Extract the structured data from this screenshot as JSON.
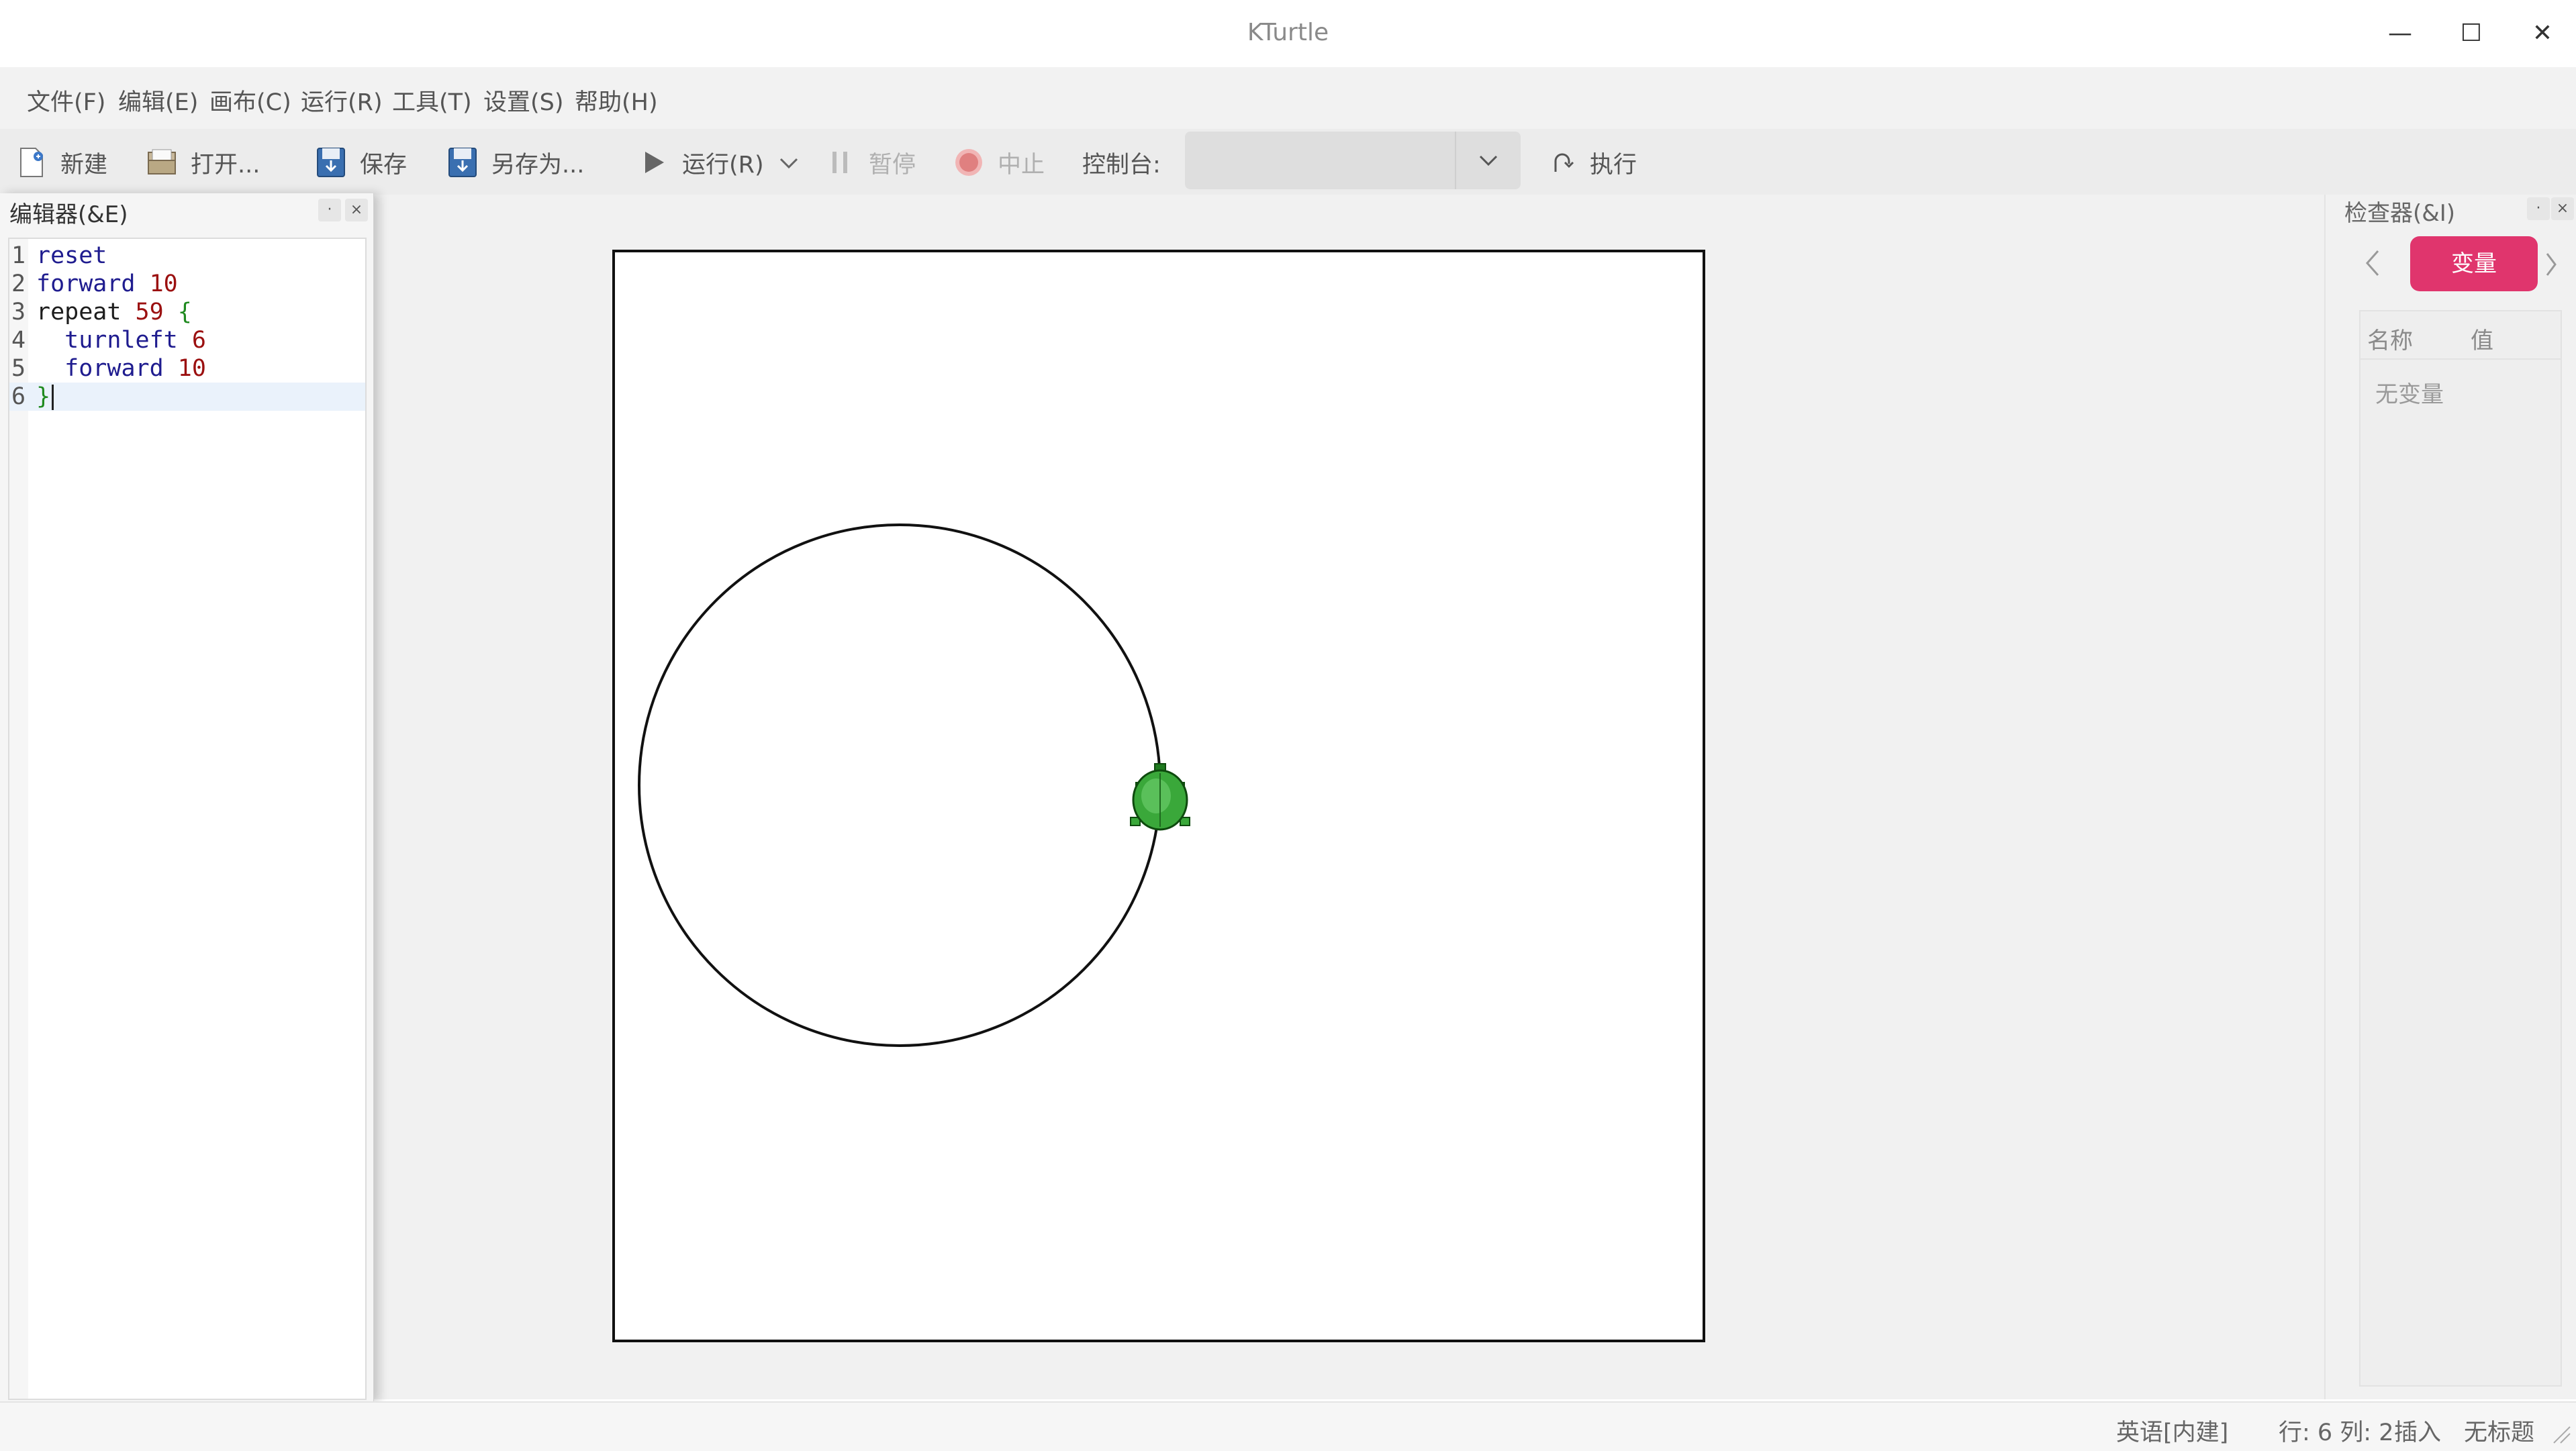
{
  "window": {
    "title": "KTurtle",
    "controls": {
      "minimize": "—",
      "maximize": "☐",
      "close": "✕"
    }
  },
  "menu": [
    "文件(F)",
    "编辑(E)",
    "画布(C)",
    "运行(R)",
    "工具(T)",
    "设置(S)",
    "帮助(H)"
  ],
  "toolbar": {
    "new_label": "新建",
    "open_label": "打开...",
    "save_label": "保存",
    "saveas_label": "另存为...",
    "run_label": "运行(R)",
    "pause_label": "暂停",
    "abort_label": "中止",
    "console_label": "控制台:",
    "console_value": "",
    "execute_label": "执行"
  },
  "editor": {
    "title": "编辑器(&E)",
    "lines": [
      {
        "n": "1",
        "cmd": "reset",
        "arg": "",
        "indent": ""
      },
      {
        "n": "2",
        "cmd": "forward",
        "arg": "10",
        "indent": ""
      },
      {
        "n": "3",
        "cmd": "repeat",
        "arg": "59",
        "indent": "",
        "brace": "{"
      },
      {
        "n": "4",
        "cmd": "turnleft",
        "arg": "6",
        "indent": "  "
      },
      {
        "n": "5",
        "cmd": "forward",
        "arg": "10",
        "indent": "  "
      },
      {
        "n": "6",
        "cmd": "",
        "arg": "",
        "indent": "",
        "brace": "}"
      }
    ]
  },
  "inspector": {
    "title": "检查器(&I)",
    "active_tab": "变量",
    "col_name": "名称",
    "col_value": "值",
    "empty_text": "无变量"
  },
  "statusbar": {
    "language": "英语[内建]",
    "position": "行: 6 列: 2",
    "mode": "插入",
    "document": "无标题"
  },
  "colors": {
    "accent_tab": "#e0356d",
    "turtle_green": "#2e9a2e",
    "keyword": "#1f1c8f",
    "number": "#9b1010"
  }
}
